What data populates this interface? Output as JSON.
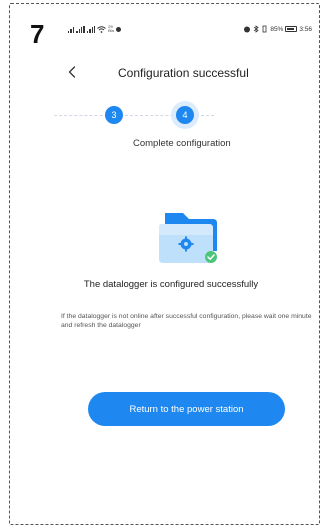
{
  "step_number": "7",
  "status_bar": {
    "signal": "☰°″",
    "speed_top": "29",
    "speed_bottom": "B/s",
    "battery_percent": "85%",
    "time": "3:56"
  },
  "header": {
    "title": "Configuration successful"
  },
  "stepper": {
    "steps": [
      "3",
      "4"
    ],
    "current_label": "Complete configuration"
  },
  "main": {
    "success_message": "The datalogger is configured successfully",
    "hint": "If the datalogger is not online after successful configuration, please wait one minute and refresh the datalogger",
    "return_button_label": "Return to the power station"
  },
  "colors": {
    "primary": "#1e88f0",
    "folder_light": "#bfe0fb",
    "check": "#4cc47a"
  }
}
